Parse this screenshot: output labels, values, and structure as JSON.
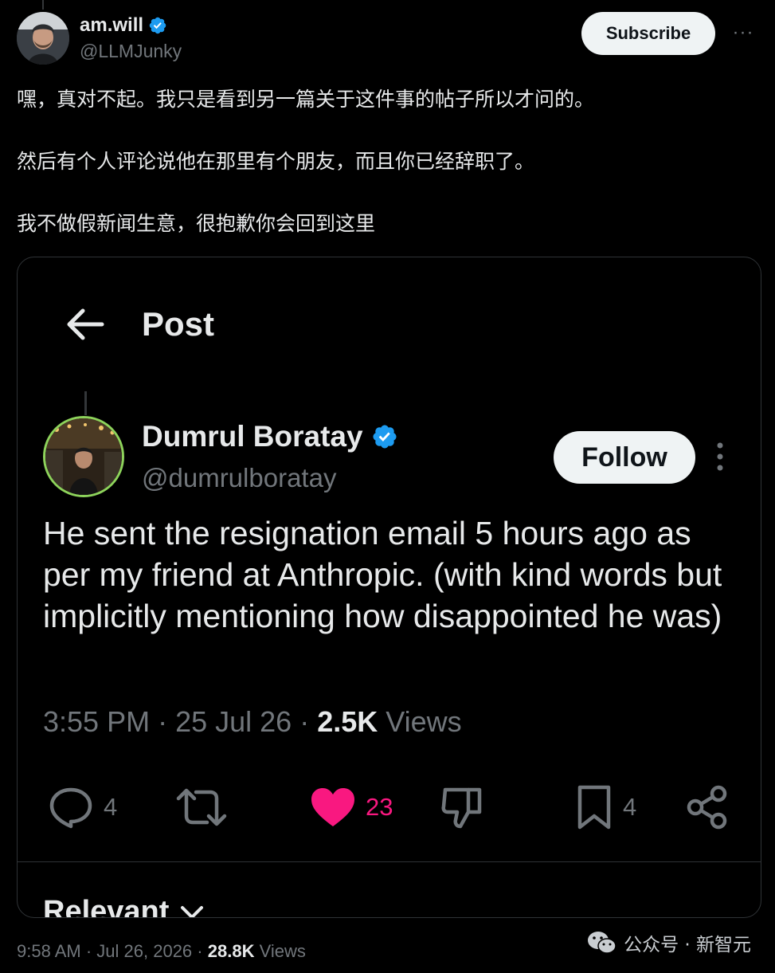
{
  "post": {
    "author_name": "am.will",
    "author_handle": "@LLMJunky",
    "subscribe_label": "Subscribe",
    "more_label": "···",
    "paragraphs": [
      "嘿，真对不起。我只是看到另一篇关于这件事的帖子所以才问的。",
      "然后有个人评论说他在那里有个朋友，而且你已经辞职了。",
      "我不做假新闻生意，很抱歉你会回到这里"
    ],
    "time": "9:58 AM",
    "date": "Jul 26, 2026",
    "views_count": "28.8K",
    "views_label": "Views"
  },
  "embed": {
    "header_title": "Post",
    "author_name": "Dumrul Boratay",
    "author_handle": "@dumrulboratay",
    "follow_label": "Follow",
    "text": "He sent the resignation email 5 hours ago as per my friend at Anthropic. (with kind words but implicitly mentioning how disappointed he was)",
    "time": "3:55 PM",
    "date": "25 Jul 26",
    "views_count": "2.5K",
    "views_label": "Views",
    "replies": "4",
    "likes": "23",
    "bookmarks": "4",
    "relevant_label": "Relevant"
  },
  "watermark": {
    "text": "公众号 · 新智元"
  },
  "colors": {
    "background": "#000000",
    "text": "#e7e9ea",
    "muted": "#71767b",
    "verified": "#1d9bf0",
    "like": "#f91880",
    "avatar_ring": "#8dd35b"
  }
}
